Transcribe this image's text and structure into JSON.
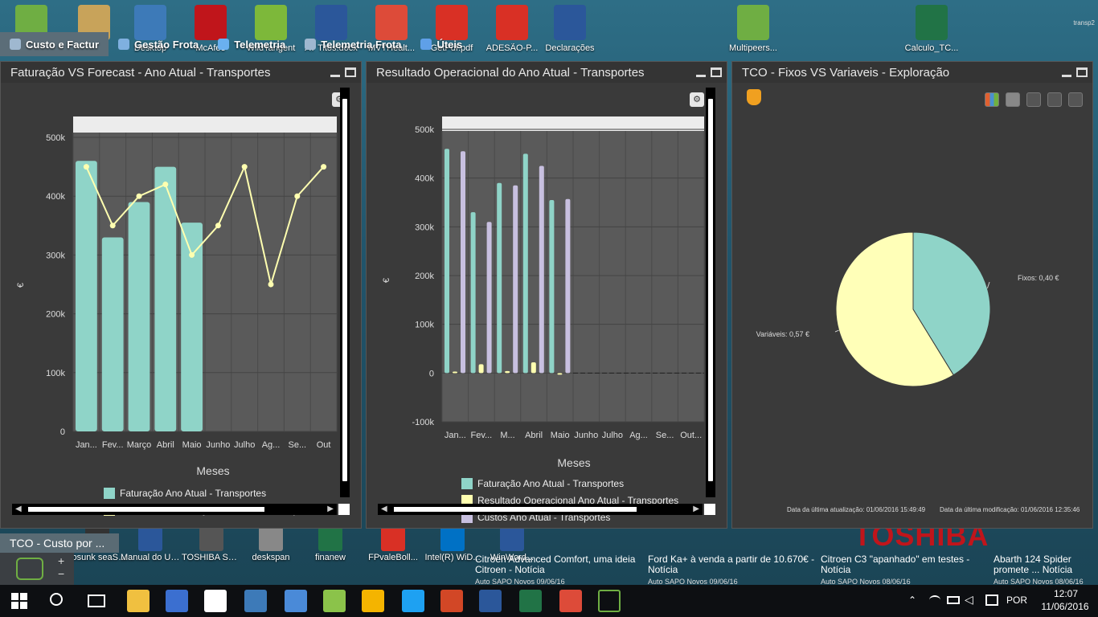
{
  "desktop": {
    "top_icons": [
      {
        "label": "",
        "color": "#6fae43"
      },
      {
        "label": "",
        "color": "#c8a35a"
      },
      {
        "label": "Desktop",
        "color": "#3d7ab8"
      },
      {
        "label": "McAfee",
        "color": "#c0151b"
      },
      {
        "label": "WildTangent",
        "color": "#7db83a"
      },
      {
        "label": "AT Titos.docx",
        "color": "#2b579a"
      },
      {
        "label": "MVTHealt...",
        "color": "#dd4b39"
      },
      {
        "label": "GetPdf.pdf",
        "color": "#d93025"
      },
      {
        "label": "ADESÃO-P...",
        "color": "#d93025"
      },
      {
        "label": "Declarações",
        "color": "#2b579a"
      },
      {
        "label": "Multipeers...",
        "color": "#6fae43"
      },
      {
        "label": "Calculo_TC...",
        "color": "#217346"
      }
    ],
    "bottom_icons": [
      {
        "label": "yosunk seaStory",
        "color": "#333333"
      },
      {
        "label": "Manual do Utilizador ...",
        "color": "#2b579a"
      },
      {
        "label": "TOSHIBA Service",
        "color": "#555555"
      },
      {
        "label": "deskspan",
        "color": "#888888"
      },
      {
        "label": "finanew",
        "color": "#217346"
      },
      {
        "label": "FPvaleBoll...",
        "color": "#d93025"
      },
      {
        "label": "Intel(R) WiD...",
        "color": "#0071c5"
      },
      {
        "label": "WinWord...",
        "color": "#2b579a"
      }
    ],
    "brand": "TOSHIBA",
    "top_right_label": "transp2"
  },
  "menu": {
    "items": [
      {
        "label": "Custo e Factur",
        "icon": "keyboard-icon",
        "active": true
      },
      {
        "label": "Gestão Frota",
        "icon": "search-icon",
        "active": false
      },
      {
        "label": "Telemetria",
        "icon": "globe-icon",
        "active": false
      },
      {
        "label": "Telemetria Frota",
        "icon": "wrench-icon",
        "active": false
      },
      {
        "label": "Úteis",
        "icon": "info-icon",
        "active": false
      }
    ]
  },
  "panels": {
    "p1": {
      "title": "Faturação VS Forecast - Ano Atual - Transportes"
    },
    "p2": {
      "title": "Resultado Operacional do Ano Atual - Transportes"
    },
    "p3": {
      "title": "TCO - Fixos VS Variaveis - Exploração"
    }
  },
  "chart_data": [
    {
      "type": "bar",
      "title": "",
      "xlabel": "Meses",
      "ylabel": "€",
      "ylim": [
        0,
        500000
      ],
      "y_ticks": [
        "0",
        "100k",
        "200k",
        "300k",
        "400k",
        "500k"
      ],
      "categories": [
        "Jan...",
        "Fev...",
        "Março",
        "Abril",
        "Maio",
        "Junho",
        "Julho",
        "Ag...",
        "Se...",
        "Out"
      ],
      "series": [
        {
          "name": "Faturação Ano Atual - Transportes",
          "type": "bar",
          "color": "#8fd4c8",
          "values": [
            460000,
            330000,
            390000,
            450000,
            355000,
            null,
            null,
            null,
            null,
            null
          ]
        },
        {
          "name": "Forecast de Faturação Ano Atual - Transportes",
          "type": "line",
          "color": "#ffffb0",
          "values": [
            450000,
            350000,
            400000,
            420000,
            300000,
            350000,
            450000,
            250000,
            400000,
            450000
          ]
        }
      ],
      "grid": true,
      "legend_position": "bottom"
    },
    {
      "type": "bar",
      "title": "",
      "xlabel": "Meses",
      "ylabel": "€",
      "ylim": [
        -100000,
        500000
      ],
      "y_ticks": [
        "-100k",
        "0",
        "100k",
        "200k",
        "300k",
        "400k",
        "500k"
      ],
      "categories": [
        "Jan...",
        "Fev...",
        "M...",
        "Abril",
        "Maio",
        "Junho",
        "Julho",
        "Ag...",
        "Se...",
        "Out..."
      ],
      "series": [
        {
          "name": "Faturação Ano Atual - Transportes",
          "color": "#8fd4c8",
          "values": [
            460000,
            330000,
            390000,
            450000,
            355000,
            0,
            0,
            0,
            0,
            0
          ]
        },
        {
          "name": "Resultado Operacional Ano Atual - Transportes",
          "color": "#ffffb0",
          "values": [
            3000,
            18000,
            4000,
            22000,
            -2000,
            0,
            0,
            0,
            0,
            0
          ]
        },
        {
          "name": "Custos Ano Atual - Transportes",
          "color": "#c8c0e0",
          "values": [
            455000,
            310000,
            385000,
            425000,
            357000,
            0,
            0,
            0,
            0,
            0
          ]
        }
      ],
      "grid": true,
      "legend_position": "bottom"
    },
    {
      "type": "pie",
      "title": "",
      "slices": [
        {
          "label": "Fixos: 0,40 €",
          "value": 0.4,
          "color": "#8fd4c8"
        },
        {
          "label": "Variáveis: 0,57 €",
          "value": 0.57,
          "color": "#ffffb8"
        }
      ]
    }
  ],
  "pie_footer": {
    "updated": "Data da última atualização: 01/06/2016 15:49:49",
    "modified": "Data da última modificação: 01/06/2016 12:35:46"
  },
  "bottom": {
    "task_thumb": "TCO - Custo por ...",
    "news": [
      {
        "title": "Citroen Advanced Comfort, uma ideia Citroen - Notícia",
        "source": "Auto SAPO Novos  09/06/16"
      },
      {
        "title": "Ford Ka+ à venda a partir de 10.670€ - Notícia",
        "source": "Auto SAPO Novos  09/06/16"
      },
      {
        "title": "Citroen C3 \"apanhado\" em testes - Notícia",
        "source": "Auto SAPO Novos  08/06/16"
      },
      {
        "title": "Abarth 124 Spider promete ... Notícia",
        "source": "Auto SAPO Novos  08/06/16"
      }
    ]
  },
  "taskbar": {
    "apps": [
      {
        "name": "file-explorer-icon",
        "color": "#f0c040"
      },
      {
        "name": "calculator-icon",
        "color": "#3b6fd0"
      },
      {
        "name": "store-icon",
        "color": "#ffffff"
      },
      {
        "name": "remote-desktop-icon",
        "color": "#3d7ab8"
      },
      {
        "name": "network-icon",
        "color": "#4a8ad8"
      },
      {
        "name": "evernote-icon",
        "color": "#8bc34a"
      },
      {
        "name": "drive-icon",
        "color": "#f4b400"
      },
      {
        "name": "ie-icon",
        "color": "#1ea1f2"
      },
      {
        "name": "powerpoint-icon",
        "color": "#d24726"
      },
      {
        "name": "word-icon",
        "color": "#2b579a"
      },
      {
        "name": "excel-icon",
        "color": "#217346"
      },
      {
        "name": "chrome-icon",
        "color": "#dd4b39"
      },
      {
        "name": "multipeers-icon",
        "color": "#6fae43"
      }
    ],
    "language": "POR",
    "time": "12:07",
    "date": "11/06/2016"
  }
}
